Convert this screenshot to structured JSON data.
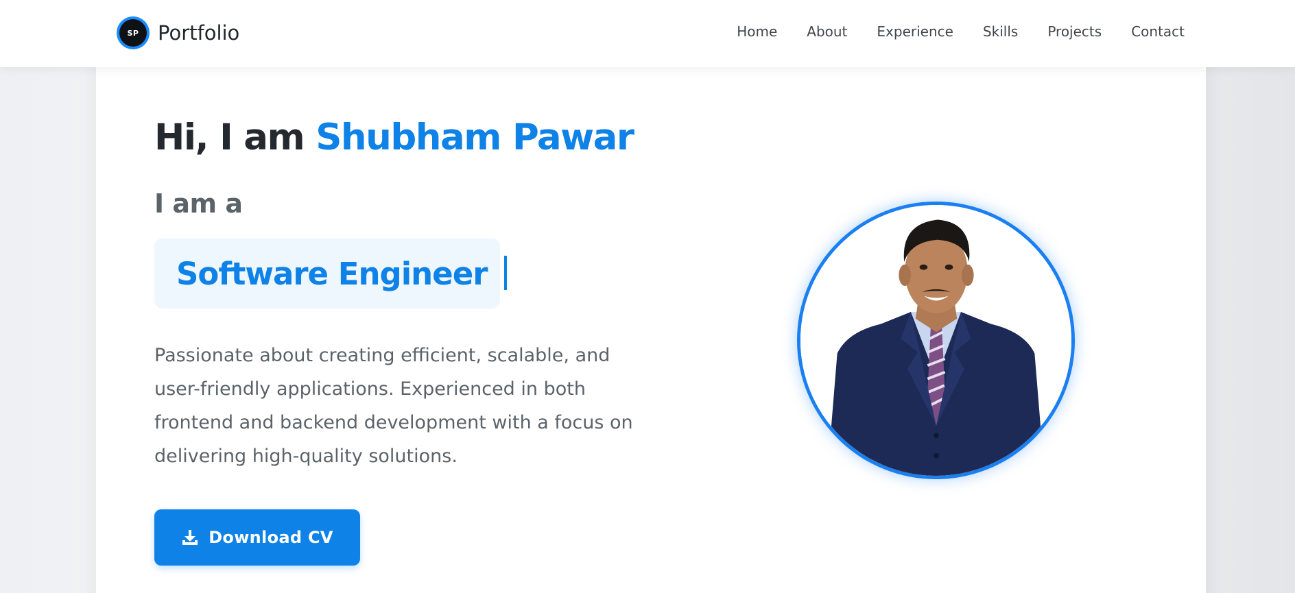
{
  "brand": {
    "logo_text": "SP",
    "name": "Portfolio"
  },
  "nav": {
    "items": [
      {
        "label": "Home"
      },
      {
        "label": "About"
      },
      {
        "label": "Experience"
      },
      {
        "label": "Skills"
      },
      {
        "label": "Projects"
      },
      {
        "label": "Contact"
      }
    ]
  },
  "hero": {
    "greeting_prefix": "Hi, I am",
    "name": "Shubham Pawar",
    "subtitle": "I am a",
    "role": "Software Engineer",
    "description": "Passionate about creating efficient, scalable, and user-friendly applications. Experienced in both frontend and backend development with a focus on delivering high-quality solutions.",
    "download_label": "Download CV"
  },
  "colors": {
    "accent": "#0e82e6",
    "heading": "#23292f",
    "body_text": "#5b636a",
    "role_bg": "#eef6fe"
  },
  "icons": {
    "download": "download-icon",
    "profile": "profile-photo"
  }
}
